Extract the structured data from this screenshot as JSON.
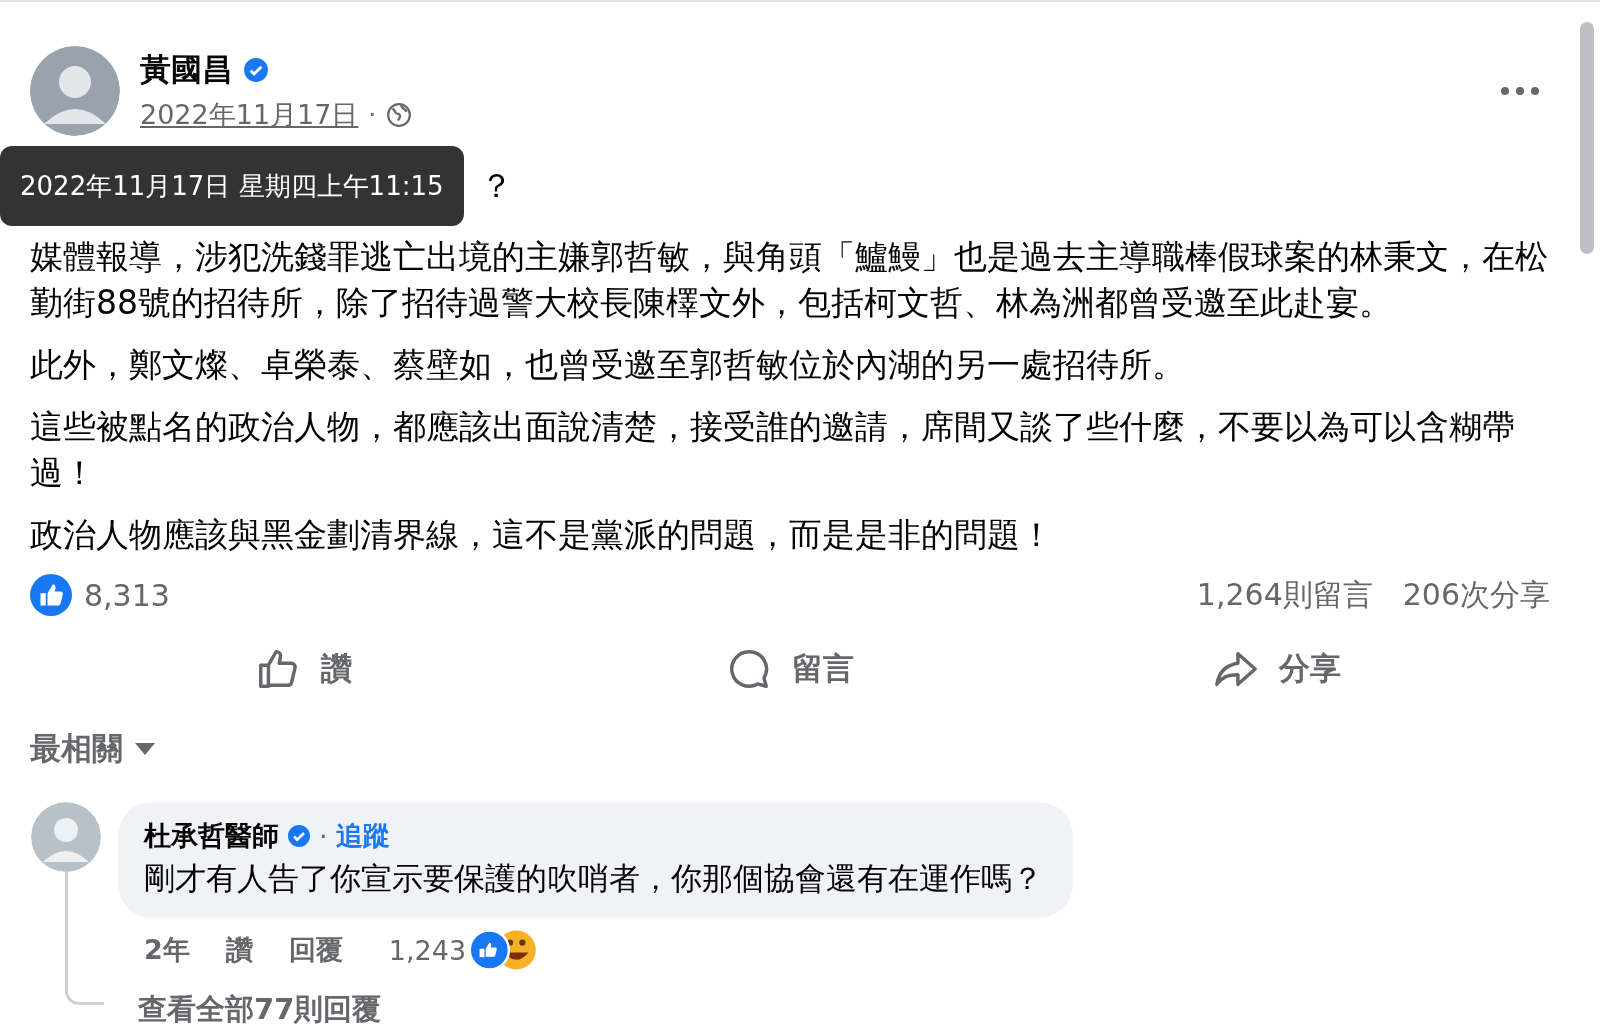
{
  "post": {
    "author": "黃國昌",
    "verified": true,
    "date": "2022年11月17日",
    "separator": "·",
    "tooltip": "2022年11月17日 星期四上午11:15",
    "paragraphs": [
      "？",
      "媒體報導，涉犯洗錢罪逃亡出境的主嫌郭哲敏，與角頭「鱸鰻」也是過去主導職棒假球案的林秉文，在松勤街88號的招待所，除了招待過警大校長陳檡文外，包括柯文哲、林為洲都曾受邀至此赴宴。",
      "此外，鄭文燦、卓榮泰、蔡壁如，也曾受邀至郭哲敏位於內湖的另一處招待所。",
      "這些被點名的政治人物，都應該出面說清楚，接受誰的邀請，席間又談了些什麼，不要以為可以含糊帶過！",
      "政治人物應該與黑金劃清界線，這不是黨派的問題，而是是非的問題！"
    ],
    "reactions": "8,313",
    "comments_count": "1,264則留言",
    "shares_count": "206次分享",
    "actions": [
      {
        "label": "讚",
        "kind": "like"
      },
      {
        "label": "留言",
        "kind": "comment"
      },
      {
        "label": "分享",
        "kind": "share"
      }
    ]
  },
  "sort": "最相關",
  "comment": {
    "author": "杜承哲醫師",
    "verified": true,
    "separator": "·",
    "follow": "追蹤",
    "text": "剛才有人告了你宣示要保護的吹哨者，你那個協會還有在運作嗎？",
    "time": "2年",
    "like": "讚",
    "reply": "回覆",
    "reactions": "1,243",
    "view_replies": "查看全部77則回覆"
  }
}
